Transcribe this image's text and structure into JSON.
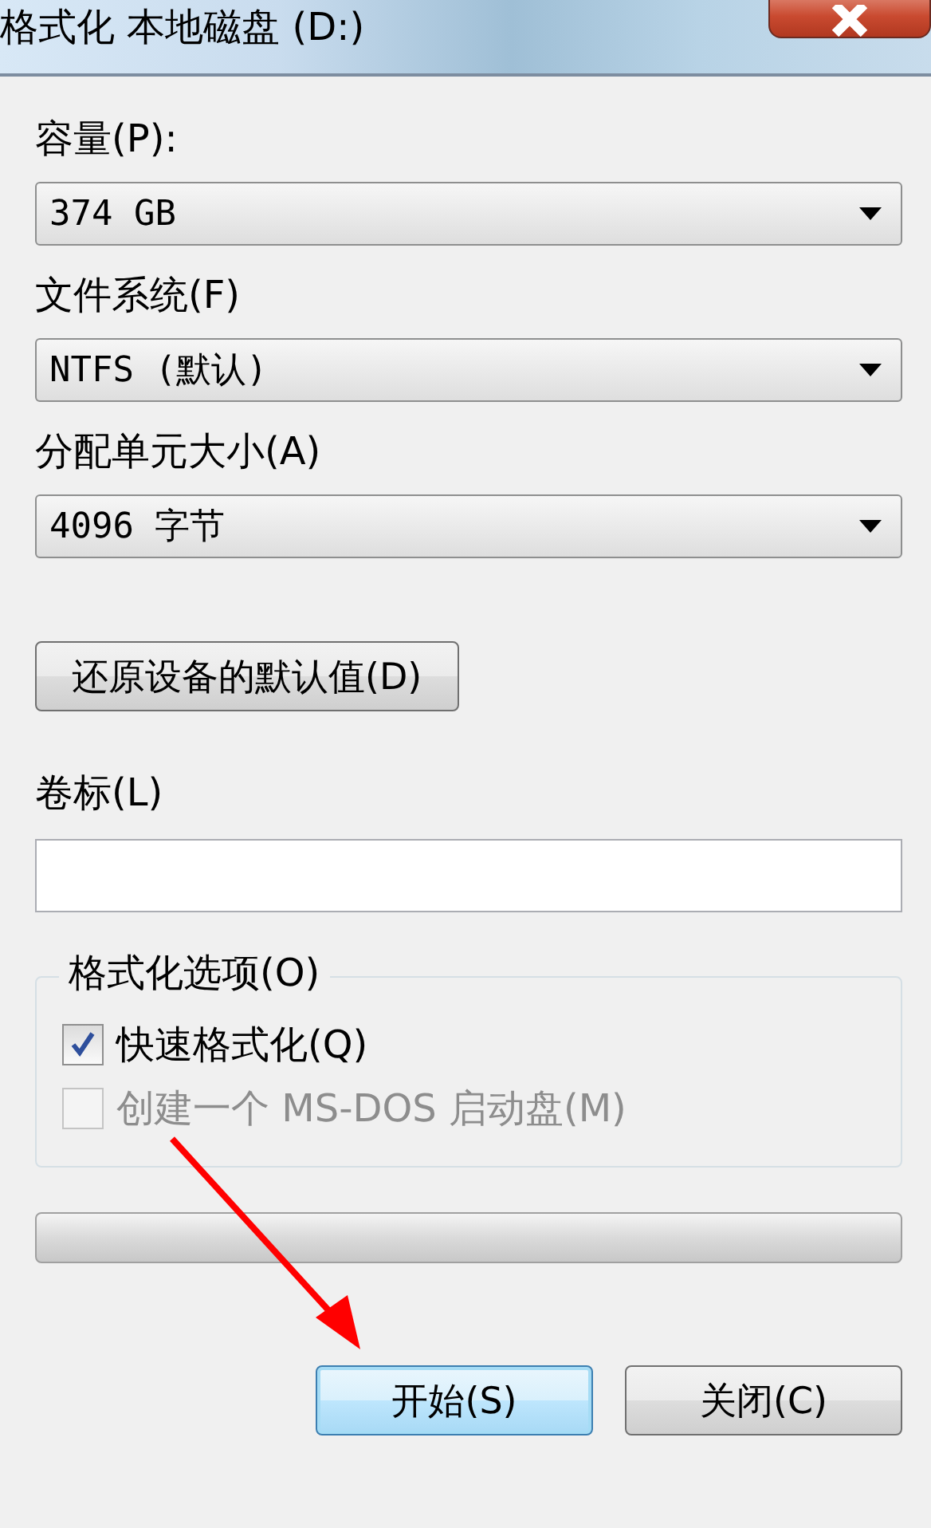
{
  "window": {
    "title": "格式化 本地磁盘 (D:)"
  },
  "fields": [
    {
      "label": "容量(P):",
      "value": "374 GB"
    },
    {
      "label": "文件系统(F)",
      "value": "NTFS (默认)"
    },
    {
      "label": "分配单元大小(A)",
      "value": "4096 字节"
    }
  ],
  "restore_button": "还原设备的默认值(D)",
  "volume_label": {
    "label": "卷标(L)"
  },
  "format_options": {
    "title": "格式化选项(O)",
    "options": [
      {
        "label": "快速格式化(Q)",
        "checked": true,
        "disabled": false
      },
      {
        "label": "创建一个 MS-DOS 启动盘(M)",
        "checked": false,
        "disabled": true
      }
    ]
  },
  "progress": {
    "level": 0
  },
  "buttons": [
    {
      "label": "开始(S)",
      "selected": true
    },
    {
      "label": "关闭(C)",
      "selected": false
    }
  ]
}
